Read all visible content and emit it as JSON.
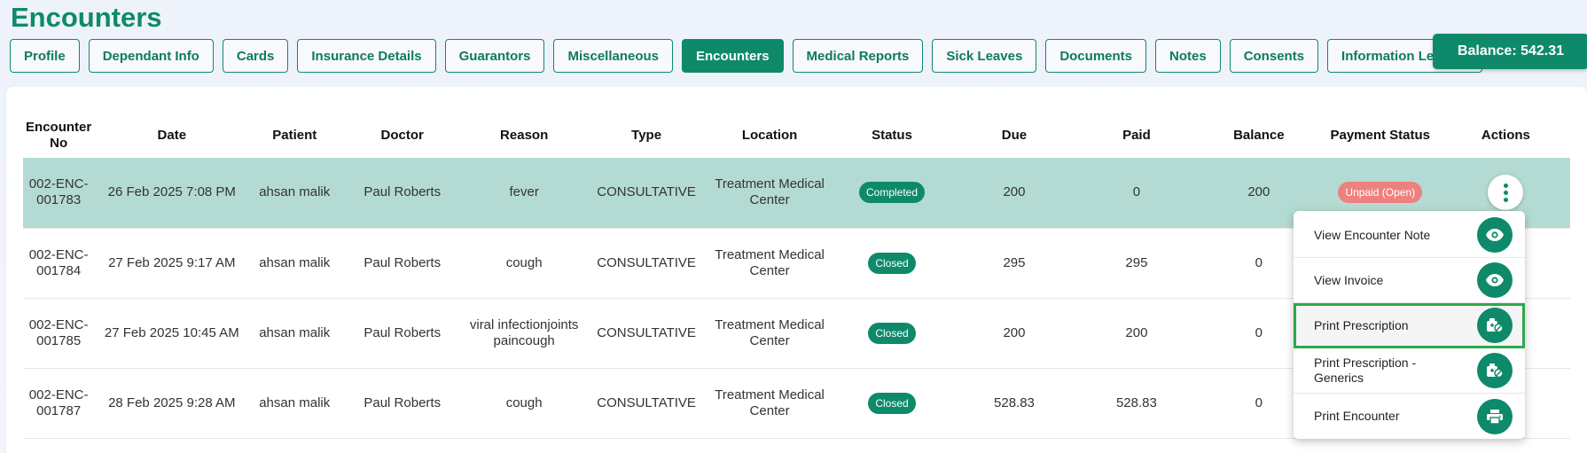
{
  "page": {
    "title": "Encounters"
  },
  "tabs": [
    {
      "label": "Profile"
    },
    {
      "label": "Dependant Info"
    },
    {
      "label": "Cards"
    },
    {
      "label": "Insurance Details"
    },
    {
      "label": "Guarantors"
    },
    {
      "label": "Miscellaneous"
    },
    {
      "label": "Encounters",
      "active": true
    },
    {
      "label": "Medical Reports"
    },
    {
      "label": "Sick Leaves"
    },
    {
      "label": "Documents"
    },
    {
      "label": "Notes"
    },
    {
      "label": "Consents"
    },
    {
      "label": "Information Leaflets"
    }
  ],
  "balance": "Balance: 542.31",
  "table": {
    "columns": [
      "Encounter No",
      "Date",
      "Patient",
      "Doctor",
      "Reason",
      "Type",
      "Location",
      "Status",
      "Due",
      "Paid",
      "Balance",
      "Payment Status",
      "Actions"
    ],
    "rows": [
      {
        "encounter_no": "002-ENC-001783",
        "date": "26 Feb 2025 7:08 PM",
        "patient": "ahsan malik",
        "doctor": "Paul Roberts",
        "reason": "fever",
        "type": "CONSULTATIVE",
        "location": "Treatment Medical Center",
        "status": "Completed",
        "due": "200",
        "paid": "0",
        "balance": "200",
        "payment_status": "Unpaid (Open)"
      },
      {
        "encounter_no": "002-ENC-001784",
        "date": "27 Feb 2025 9:17 AM",
        "patient": "ahsan malik",
        "doctor": "Paul Roberts",
        "reason": "cough",
        "type": "CONSULTATIVE",
        "location": "Treatment Medical Center",
        "status": "Closed",
        "due": "295",
        "paid": "295",
        "balance": "0",
        "payment_status": ""
      },
      {
        "encounter_no": "002-ENC-001785",
        "date": "27 Feb 2025 10:45 AM",
        "patient": "ahsan malik",
        "doctor": "Paul Roberts",
        "reason": "viral infectionjoints paincough",
        "type": "CONSULTATIVE",
        "location": "Treatment Medical Center",
        "status": "Closed",
        "due": "200",
        "paid": "200",
        "balance": "0",
        "payment_status": ""
      },
      {
        "encounter_no": "002-ENC-001787",
        "date": "28 Feb 2025 9:28 AM",
        "patient": "ahsan malik",
        "doctor": "Paul Roberts",
        "reason": "cough",
        "type": "CONSULTATIVE",
        "location": "Treatment Medical Center",
        "status": "Closed",
        "due": "528.83",
        "paid": "528.83",
        "balance": "0",
        "payment_status": ""
      }
    ]
  },
  "actions_menu": [
    {
      "label": "View Encounter Note",
      "icon": "eye-icon"
    },
    {
      "label": "View Invoice",
      "icon": "eye-icon"
    },
    {
      "label": "Print Prescription",
      "icon": "prescription-icon",
      "highlighted": true
    },
    {
      "label": "Print Prescription - Generics",
      "icon": "prescription-icon"
    },
    {
      "label": "Print Encounter",
      "icon": "printer-icon"
    }
  ],
  "colors": {
    "brand": "#0e8a6a",
    "selected_row": "#b4dbd3",
    "unpaid": "#ee8080",
    "highlight_border": "#2ea84c"
  }
}
